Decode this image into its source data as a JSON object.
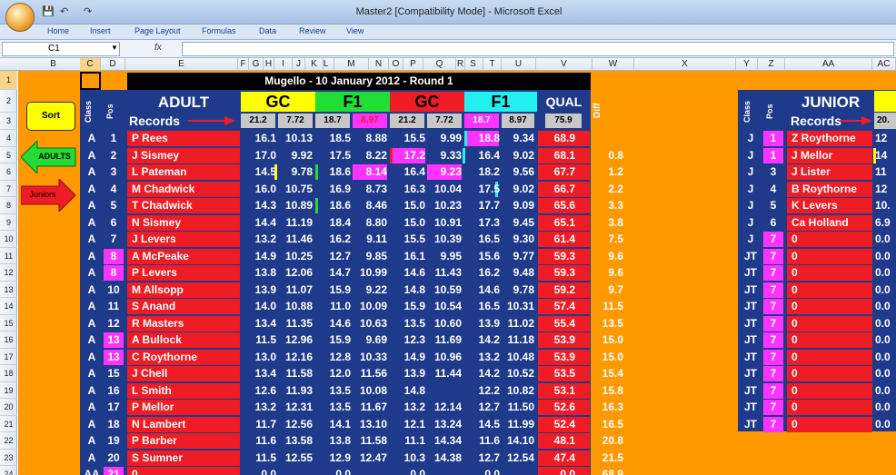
{
  "window": {
    "title": "Master2  [Compatibility Mode] - Microsoft Excel"
  },
  "ribbon_tabs": [
    "Home",
    "Insert",
    "Page Layout",
    "Formulas",
    "Data",
    "Review",
    "View"
  ],
  "formula_bar": {
    "name_box": "C1",
    "fx": "fx",
    "value": ""
  },
  "col_headers": [
    "B",
    "C",
    "D",
    "E",
    "F",
    "G",
    "H",
    "I",
    "J",
    "K",
    "L",
    "M",
    "N",
    "O",
    "P",
    "Q",
    "R",
    "S",
    "T",
    "U",
    "V",
    "W",
    "X",
    "Y",
    "Z",
    "AA",
    "AC"
  ],
  "row_headers": [
    "1",
    "2",
    "3",
    "4",
    "5",
    "6",
    "7",
    "8",
    "9",
    "10",
    "11",
    "12",
    "13",
    "14",
    "15",
    "16",
    "17",
    "18",
    "19",
    "20",
    "21",
    "22",
    "23",
    "24"
  ],
  "banner": "Mugello - 10 January 2012 - Round 1",
  "buttons": {
    "sort": "Sort",
    "adults": "ADULTS",
    "juniors": "Juniors"
  },
  "adult": {
    "section": "ADULT",
    "class_hdr": "Class",
    "pos_hdr": "Pos",
    "records": "Records",
    "groups": [
      "GC",
      "F1",
      "GC",
      "F1",
      "QUAL"
    ],
    "diff_hdr": "Diff",
    "record_values": [
      "21.2",
      "7.72",
      "18.7",
      "8.97",
      "21.2",
      "7.72",
      "18.7",
      "8.97",
      "75.9"
    ],
    "rows": [
      [
        "A",
        "1",
        "P Rees",
        "16.1",
        "10.13",
        "18.5",
        "8.88",
        "15.5",
        "9.99",
        "18.8",
        "9.34",
        "68.9",
        ""
      ],
      [
        "A",
        "2",
        "J Sismey",
        "17.0",
        "9.92",
        "17.5",
        "8.22",
        "17.2",
        "9.33",
        "16.4",
        "9.02",
        "68.1",
        "0.8"
      ],
      [
        "A",
        "3",
        "L Pateman",
        "14.5",
        "9.78",
        "18.6",
        "8.14",
        "16.4",
        "9.23",
        "18.2",
        "9.56",
        "67.7",
        "1.2"
      ],
      [
        "A",
        "4",
        "M Chadwick",
        "16.0",
        "10.75",
        "16.9",
        "8.73",
        "16.3",
        "10.04",
        "17.5",
        "9.02",
        "66.7",
        "2.2"
      ],
      [
        "A",
        "5",
        "T Chadwick",
        "14.3",
        "10.89",
        "18.6",
        "8.46",
        "15.0",
        "10.23",
        "17.7",
        "9.09",
        "65.6",
        "3.3"
      ],
      [
        "A",
        "6",
        "N Sismey",
        "14.4",
        "11.19",
        "18.4",
        "8.80",
        "15.0",
        "10.91",
        "17.3",
        "9.45",
        "65.1",
        "3.8"
      ],
      [
        "A",
        "7",
        "J Levers",
        "13.2",
        "11.46",
        "16.2",
        "9.11",
        "15.5",
        "10.39",
        "16.5",
        "9.30",
        "61.4",
        "7.5"
      ],
      [
        "A",
        "8",
        "A McPeake",
        "14.9",
        "10.25",
        "12.7",
        "9.85",
        "16.1",
        "9.95",
        "15.6",
        "9.77",
        "59.3",
        "9.6"
      ],
      [
        "A",
        "8",
        "P Levers",
        "13.8",
        "12.06",
        "14.7",
        "10.99",
        "14.6",
        "11.43",
        "16.2",
        "9.48",
        "59.3",
        "9.6"
      ],
      [
        "A",
        "10",
        "M Allsopp",
        "13.9",
        "11.07",
        "15.9",
        "9.22",
        "14.8",
        "10.59",
        "14.6",
        "9.78",
        "59.2",
        "9.7"
      ],
      [
        "A",
        "11",
        "S Anand",
        "14.0",
        "10.88",
        "11.0",
        "10.09",
        "15.9",
        "10.54",
        "16.5",
        "10.31",
        "57.4",
        "11.5"
      ],
      [
        "A",
        "12",
        "R Masters",
        "13.4",
        "11.35",
        "14.6",
        "10.63",
        "13.5",
        "10.60",
        "13.9",
        "11.02",
        "55.4",
        "13.5"
      ],
      [
        "A",
        "13",
        "A Bullock",
        "11.5",
        "12.96",
        "15.9",
        "9.69",
        "12.3",
        "11.69",
        "14.2",
        "11.18",
        "53.9",
        "15.0"
      ],
      [
        "A",
        "13",
        "C Roythorne",
        "13.0",
        "12.16",
        "12.8",
        "10.33",
        "14.9",
        "10.96",
        "13.2",
        "10.48",
        "53.9",
        "15.0"
      ],
      [
        "A",
        "15",
        "J Chell",
        "13.4",
        "11.58",
        "12.0",
        "11.56",
        "13.9",
        "11.44",
        "14.2",
        "10.52",
        "53.5",
        "15.4"
      ],
      [
        "A",
        "16",
        "L Smith",
        "12.6",
        "11.93",
        "13.5",
        "10.08",
        "14.8",
        "",
        "12.2",
        "10.82",
        "53.1",
        "15.8"
      ],
      [
        "A",
        "17",
        "P Mellor",
        "13.2",
        "12.31",
        "13.5",
        "11.67",
        "13.2",
        "12.14",
        "12.7",
        "11.50",
        "52.6",
        "16.3"
      ],
      [
        "A",
        "18",
        "N Lambert",
        "11.7",
        "12.56",
        "14.1",
        "13.10",
        "12.1",
        "13.24",
        "14.5",
        "11.99",
        "52.4",
        "16.5"
      ],
      [
        "A",
        "19",
        "P Barber",
        "11.6",
        "13.58",
        "13.8",
        "11.58",
        "11.1",
        "14.34",
        "11.6",
        "14.10",
        "48.1",
        "20.8"
      ],
      [
        "A",
        "20",
        "S Sumner",
        "11.5",
        "12.55",
        "12.9",
        "12.47",
        "10.3",
        "14.38",
        "12.7",
        "12.54",
        "47.4",
        "21.5"
      ],
      [
        "AA",
        "21",
        "0",
        "0.0",
        "",
        "0.0",
        "",
        "0.0",
        "",
        "0.0",
        "",
        "0.0",
        "68.9"
      ]
    ]
  },
  "junior": {
    "section": "JUNIOR",
    "class_hdr": "Class",
    "pos_hdr": "Pos",
    "records": "Records",
    "record_value": "20.",
    "rows": [
      [
        "J",
        "1",
        "Z Roythorne",
        "12"
      ],
      [
        "J",
        "1",
        "J Mellor",
        "14"
      ],
      [
        "J",
        "3",
        "J Lister",
        "11"
      ],
      [
        "J",
        "4",
        "B Roythorne",
        "12"
      ],
      [
        "J",
        "5",
        "K Levers",
        "10."
      ],
      [
        "J",
        "6",
        "Ca Holland",
        "6.9"
      ],
      [
        "J",
        "7",
        "0",
        "0.0"
      ],
      [
        "JT",
        "7",
        "0",
        "0.0"
      ],
      [
        "JT",
        "7",
        "0",
        "0.0"
      ],
      [
        "JT",
        "7",
        "0",
        "0.0"
      ],
      [
        "JT",
        "7",
        "0",
        "0.0"
      ],
      [
        "JT",
        "7",
        "0",
        "0.0"
      ],
      [
        "JT",
        "7",
        "0",
        "0.0"
      ],
      [
        "JT",
        "7",
        "0",
        "0.0"
      ],
      [
        "JT",
        "7",
        "0",
        "0.0"
      ],
      [
        "JT",
        "7",
        "0",
        "0.0"
      ],
      [
        "JT",
        "7",
        "0",
        "0.0"
      ],
      [
        "JT",
        "7",
        "0",
        "0.0"
      ]
    ]
  },
  "colors": {
    "gc": "#ffff00",
    "f1": "#22dd33",
    "gc2": "#ee1c24",
    "f1b": "#22f0f0",
    "qual": "#1f3a8a",
    "highlight": "#ff33ff",
    "name_bg": "#ee1c24",
    "panel": "#1f3a8a",
    "background": "#ff9900"
  }
}
